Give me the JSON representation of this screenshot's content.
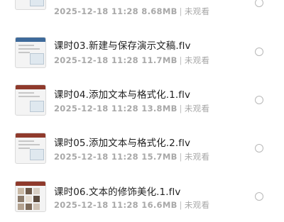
{
  "files": [
    {
      "title": "",
      "date": "2025-12-18 11:28",
      "size": "8.68MB",
      "status": "未观看"
    },
    {
      "title": "课时03.新建与保存演示文稿.flv",
      "date": "2025-12-18 11:28",
      "size": "11.7MB",
      "status": "未观看"
    },
    {
      "title": "课时04.添加文本与格式化.1.flv",
      "date": "2025-12-18 11:28",
      "size": "13.8MB",
      "status": "未观看"
    },
    {
      "title": "课时05.添加文本与格式化.2.flv",
      "date": "2025-12-18 11:28",
      "size": "15.7MB",
      "status": "未观看"
    },
    {
      "title": "课时06.文本的修饰美化.1.flv",
      "date": "2025-12-18 11:28",
      "size": "16.6MB",
      "status": "未观看"
    }
  ],
  "separator": "|",
  "colors": {
    "text": "#222222",
    "meta": "#a8a8a8",
    "radio": "#b8b8b8",
    "thumb_accent": "#8f3a2c"
  }
}
